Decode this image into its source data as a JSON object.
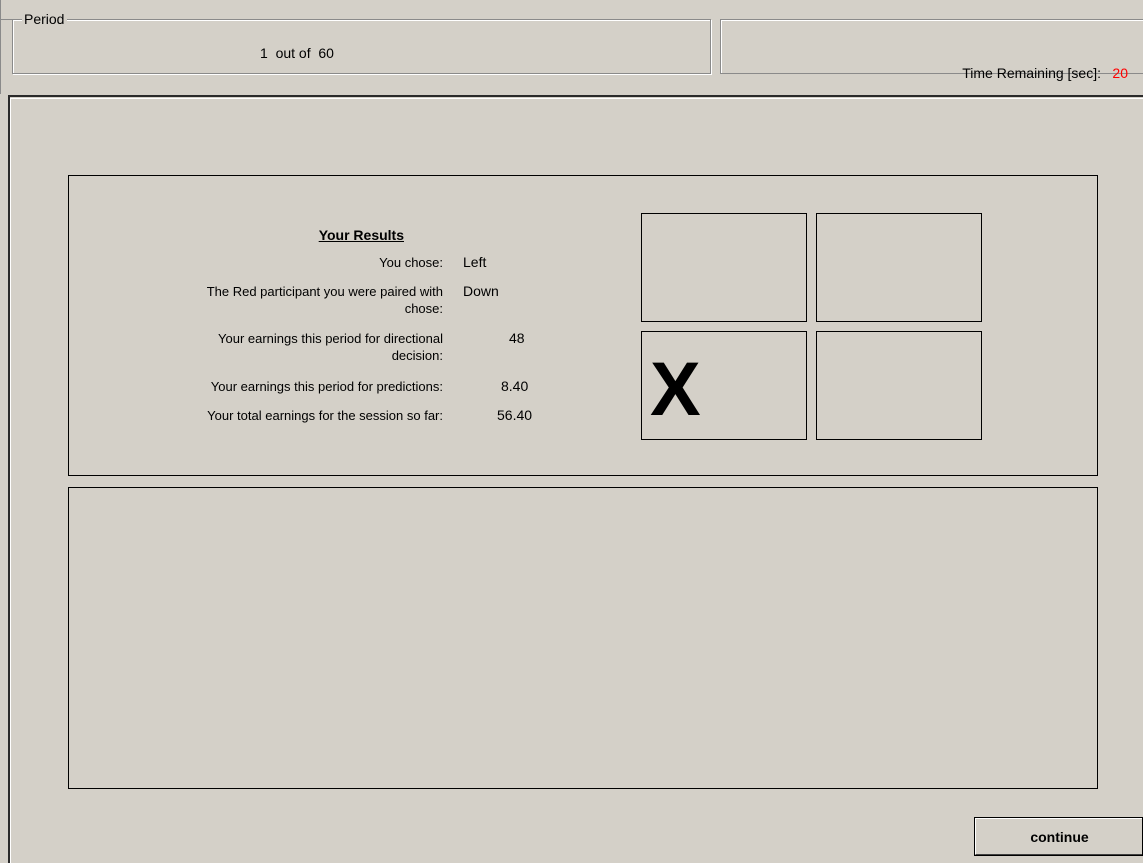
{
  "period": {
    "legend": "Period",
    "current": "1",
    "separator": "out of",
    "total": "60"
  },
  "timer": {
    "label": "Time Remaining [sec]:",
    "value": "20",
    "value_color": "#ff0000"
  },
  "results": {
    "title": "Your Results",
    "rows": [
      {
        "label": "You chose:",
        "value": "Left"
      },
      {
        "label_line1": "The Red participant you were paired with",
        "label_line2": "chose:",
        "value": "Down"
      },
      {
        "label_line1": "Your earnings this period for directional",
        "label_line2": "decision:",
        "value": "48"
      },
      {
        "label": "Your earnings this period for predictions:",
        "value": "8.40"
      },
      {
        "label": "Your total earnings for the session so far:",
        "value": "56.40"
      }
    ]
  },
  "grid": {
    "cells": [
      {
        "position": "top-left",
        "mark": ""
      },
      {
        "position": "top-right",
        "mark": ""
      },
      {
        "position": "bottom-left",
        "mark": "X"
      },
      {
        "position": "bottom-right",
        "mark": ""
      }
    ]
  },
  "message_panel": {
    "text": ""
  },
  "buttons": {
    "continue_label": "continue"
  }
}
